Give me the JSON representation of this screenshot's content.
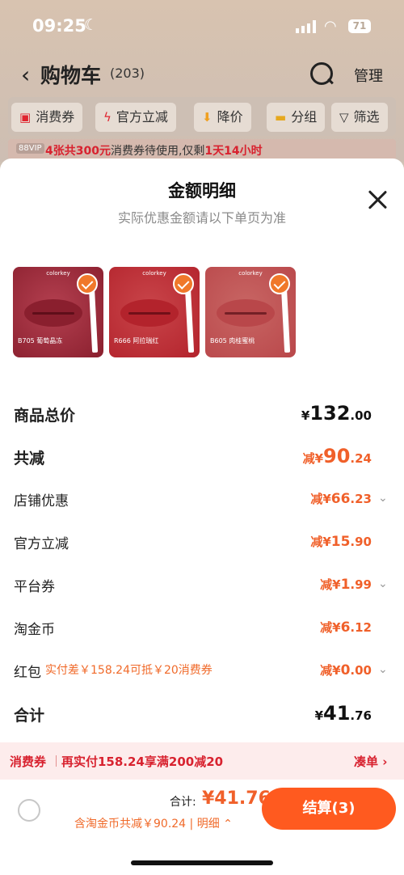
{
  "status_bar": {
    "time": "09:25",
    "battery": "71"
  },
  "header": {
    "title": "购物车",
    "count": "(203)",
    "manage": "管理"
  },
  "filters": [
    {
      "label": "消费券",
      "icon": "coupon-icon"
    },
    {
      "label": "官方立减",
      "icon": "lightning-icon"
    },
    {
      "label": "降价",
      "icon": "price-drop-icon"
    },
    {
      "label": "分组",
      "icon": "folder-icon"
    },
    {
      "label": "筛选",
      "icon": "filter-icon"
    }
  ],
  "banner": {
    "vip": "88VIP",
    "highlight1": "4张共300元",
    "text1": "消费券待使用,仅剩",
    "highlight2": "1天14小时"
  },
  "sheet": {
    "title": "金额明细",
    "subtitle": "实际优惠金额请以下单页为准"
  },
  "products": [
    {
      "brand": "colorkey",
      "caption": "B705 葡萄晶冻",
      "color": "#8a1f2e",
      "bg": "#b44050"
    },
    {
      "brand": "colorkey",
      "caption": "R666 阿拉瑞红",
      "color": "#b3232c",
      "bg": "#c9454a"
    },
    {
      "brand": "colorkey",
      "caption": "B605 肉桂蜜桃",
      "color": "#b9474a",
      "bg": "#c86664"
    }
  ],
  "rows": {
    "subtotal": {
      "label": "商品总价",
      "currency": "¥",
      "int": "132",
      "dec": ".00"
    },
    "discount": {
      "label": "共减",
      "prefix": "减¥",
      "int": "90",
      "dec": ".24"
    },
    "shop": {
      "label": "店铺优惠",
      "prefix": "减¥",
      "int": "66",
      "dec": ".23"
    },
    "official": {
      "label": "官方立减",
      "prefix": "减¥",
      "int": "15",
      "dec": ".90"
    },
    "platform": {
      "label": "平台券",
      "prefix": "减¥",
      "int": "1",
      "dec": ".99"
    },
    "coin": {
      "label": "淘金币",
      "prefix": "减¥",
      "int": "6",
      "dec": ".12"
    },
    "redpacket": {
      "label": "红包",
      "note": "实付差￥158.24可抵￥20消费券",
      "prefix": "减¥",
      "int": "0",
      "dec": ".00"
    },
    "total": {
      "label": "合计",
      "currency": "¥",
      "int": "41",
      "dec": ".76"
    }
  },
  "promo": {
    "tag": "消费券",
    "text": "再实付158.24享满200减20",
    "action": "凑单 ›"
  },
  "footer": {
    "total_label": "合计:",
    "total_value": "¥41.76",
    "note": "含淘金币共减￥90.24 | 明细 ⌃",
    "checkout": "结算(3)"
  }
}
